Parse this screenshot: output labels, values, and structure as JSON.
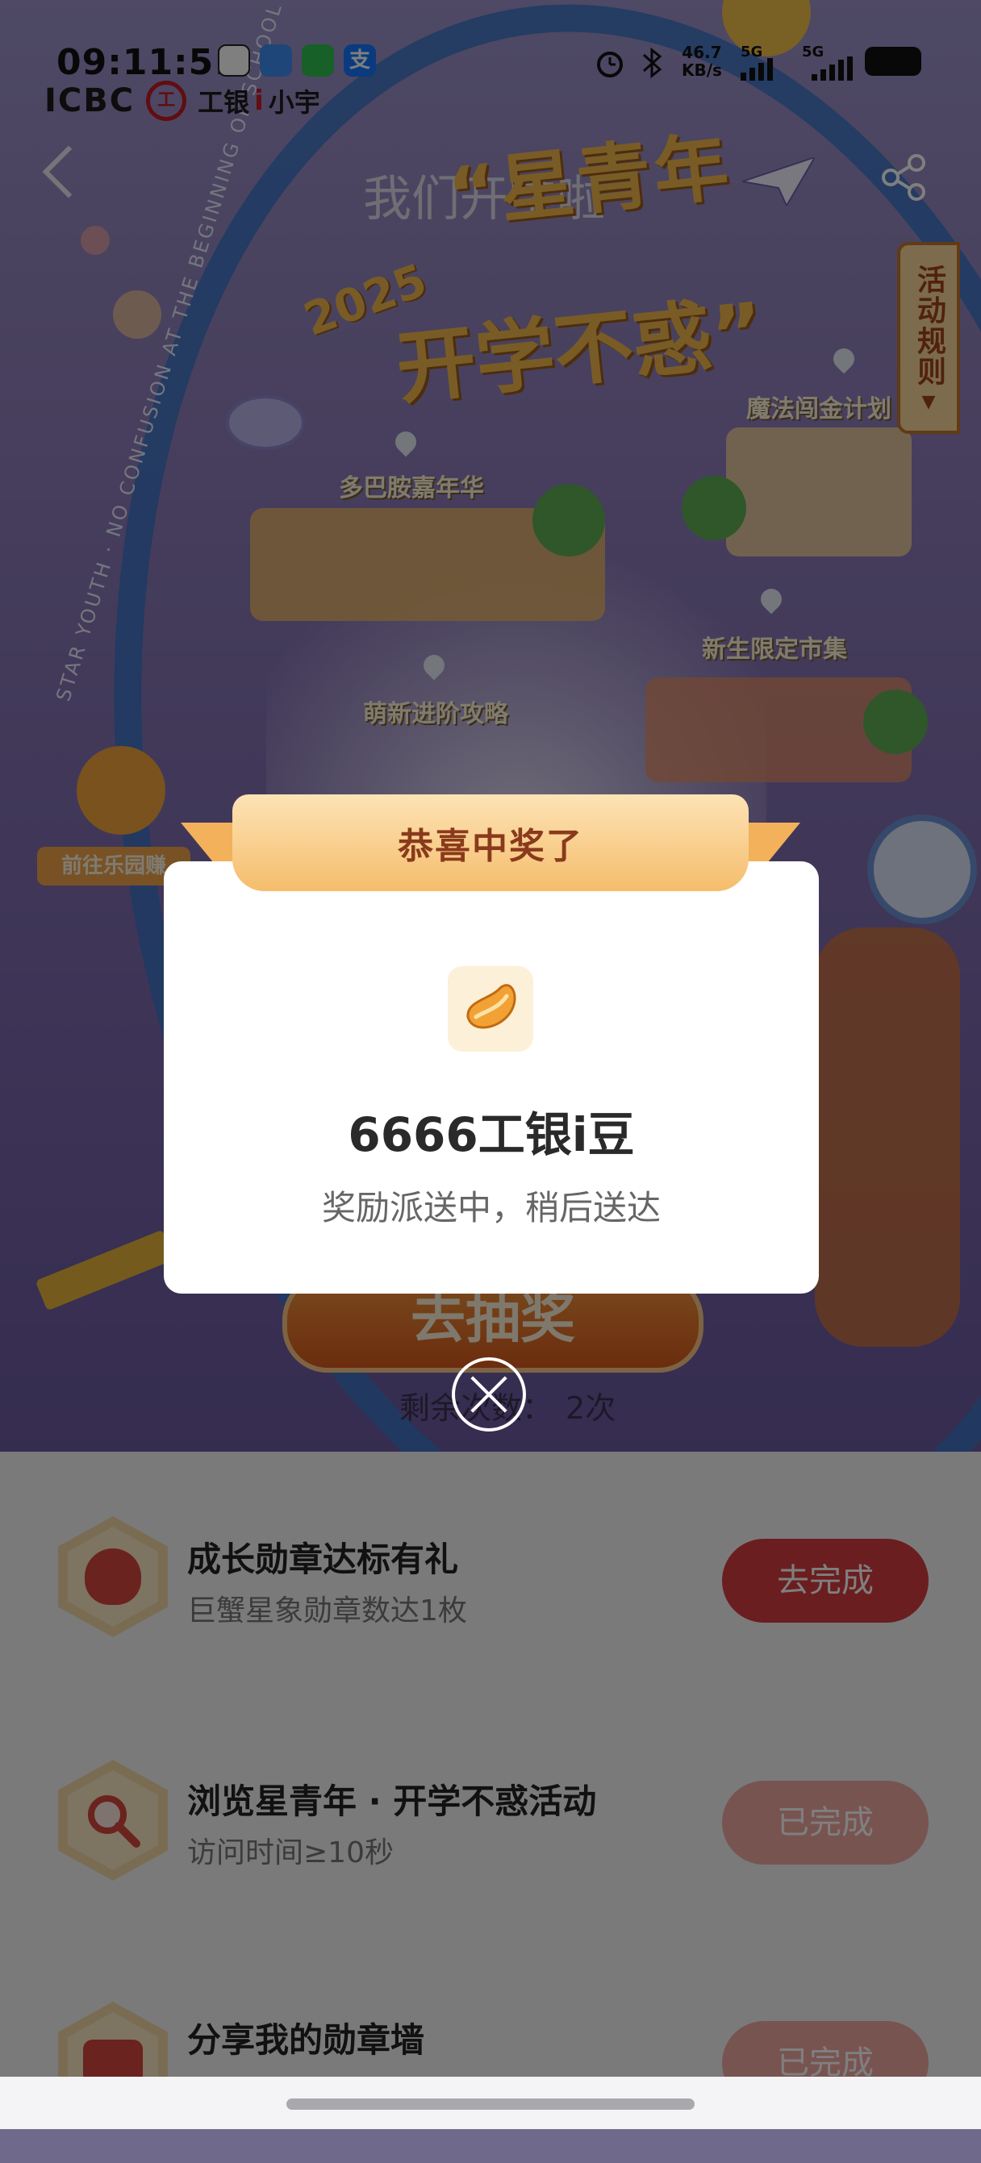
{
  "status_bar": {
    "time": "09:11:51",
    "network_speed": "46.7",
    "network_unit": "KB/s",
    "sim1": "5G",
    "sim2": "5G",
    "app_icons": [
      "qq-icon",
      "message-app-icon",
      "wechat-icon",
      "alipay-icon"
    ]
  },
  "brand": {
    "bank": "ICBC",
    "logo_glyph": "工",
    "name_a": "工银",
    "name_i": "i",
    "name_b": "小宇"
  },
  "hero": {
    "subtitle": "我们开学啦",
    "title_line1": "“星青年",
    "title_line2": "开学不惑”",
    "year": "2025",
    "curved_caption": "STAR YOUTH · NO CONFUSION AT THE BEGINNING OF SCHOOL",
    "map_labels": [
      "多巴胺嘉年华",
      "魔法闯金计划",
      "新生限定市集",
      "萌新进阶攻略"
    ],
    "rules_tab": "活动规则",
    "promo_tag": "前往乐园赚",
    "draw_button": "去抽奖",
    "remaining_label": "剩余次数：",
    "remaining_count": "2次"
  },
  "modal": {
    "ribbon_title": "恭喜中奖了",
    "prize_name": "6666工银i豆",
    "prize_message": "奖励派送中，稍后送达"
  },
  "tasks": [
    {
      "title": "成长勋章达标有礼",
      "desc": "巨蟹星象勋章数达1枚",
      "button": "去完成",
      "state": "todo",
      "icon": "money-bag-icon"
    },
    {
      "title": "浏览星青年 · 开学不惑活动",
      "desc": "访问时间≥10秒",
      "button": "已完成",
      "state": "done",
      "icon": "magnifier-icon"
    },
    {
      "title": "分享我的勋章墙",
      "desc": "",
      "button": "已完成",
      "state": "done",
      "icon": "wallet-icon"
    }
  ],
  "colors": {
    "accent_red": "#d73c3f",
    "done_pink": "#f0a9a3",
    "ribbon_gold": "#f5bd6c",
    "title_gold": "#f3b84a"
  }
}
